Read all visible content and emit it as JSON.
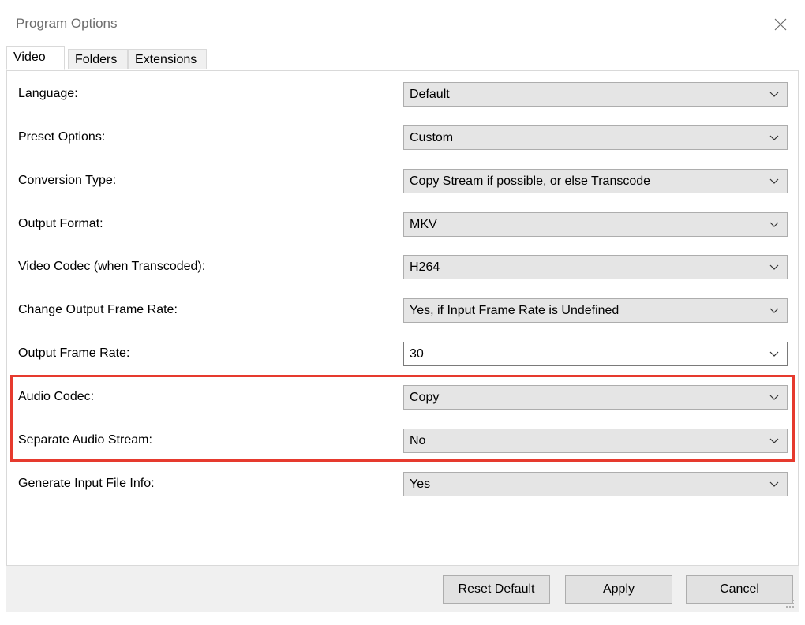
{
  "window": {
    "title": "Program Options"
  },
  "tabs": [
    {
      "label": "Video",
      "active": true
    },
    {
      "label": "Folders",
      "active": false
    },
    {
      "label": "Extensions",
      "active": false
    }
  ],
  "settings": [
    {
      "label": "Language:",
      "value": "Default"
    },
    {
      "label": "Preset Options:",
      "value": "Custom"
    },
    {
      "label": "Conversion Type:",
      "value": "Copy Stream if possible, or else Transcode"
    },
    {
      "label": "Output Format:",
      "value": "MKV"
    },
    {
      "label": "Video Codec (when Transcoded):",
      "value": "H264"
    },
    {
      "label": "Change Output Frame Rate:",
      "value": "Yes, if Input Frame Rate is Undefined"
    },
    {
      "label": "Output Frame Rate:",
      "value": "30"
    },
    {
      "label": "Audio Codec:",
      "value": "Copy"
    },
    {
      "label": "Separate Audio Stream:",
      "value": "No"
    },
    {
      "label": "Generate Input File Info:",
      "value": "Yes"
    }
  ],
  "buttons": {
    "reset_default": "Reset Default",
    "apply": "Apply",
    "cancel": "Cancel"
  },
  "icons": {
    "close": "close-icon",
    "dropdown": "chevron-down-icon",
    "resize": "resize-grip-icon"
  },
  "colors": {
    "highlight": "#e63a2e",
    "select_bg": "#e5e5e5",
    "footer_bg": "#f0f0f0"
  }
}
